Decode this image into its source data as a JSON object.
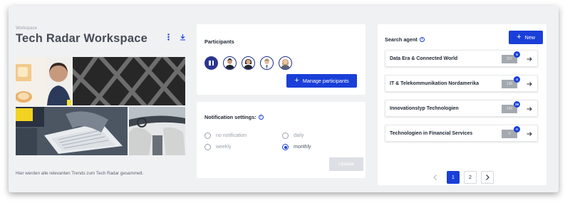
{
  "workspace": {
    "label": "Workspace",
    "title": "Tech Radar Workspace",
    "description": "Hier werden alle relevanten Trends zum Tech Radar gesammelt.",
    "actions": [
      {
        "icon": "more-vertical-icon"
      },
      {
        "icon": "download-icon"
      }
    ]
  },
  "participants": {
    "title": "Participants",
    "manage_label": "Manage participants",
    "avatars": [
      "pause-icon",
      "avatar",
      "avatar",
      "avatar",
      "avatar"
    ]
  },
  "notifications": {
    "title": "Notification settings:",
    "options": [
      {
        "label": "no notification",
        "checked": false
      },
      {
        "label": "daily",
        "checked": false
      },
      {
        "label": "weekly",
        "checked": false
      },
      {
        "label": "monthly",
        "checked": true
      }
    ],
    "update_label": "Update"
  },
  "search_agent": {
    "title": "Search agent",
    "new_label": "New",
    "items": [
      {
        "name": "Data Era & Connected World",
        "count": "207",
        "badge": "5"
      },
      {
        "name": "IT & Telekommunikation Nordamerika",
        "count": "136",
        "badge": "4"
      },
      {
        "name": "Innovationstyp Technologien",
        "count": "249",
        "badge": "26"
      },
      {
        "name": "Technologien in Financial Services",
        "count": "0",
        "badge": "0"
      }
    ]
  },
  "pagination": {
    "pages": [
      "1",
      "2"
    ],
    "current": "1"
  },
  "colors": {
    "primary": "#1a3fd8",
    "background": "#f0f1f3",
    "text": "#1f2733"
  }
}
